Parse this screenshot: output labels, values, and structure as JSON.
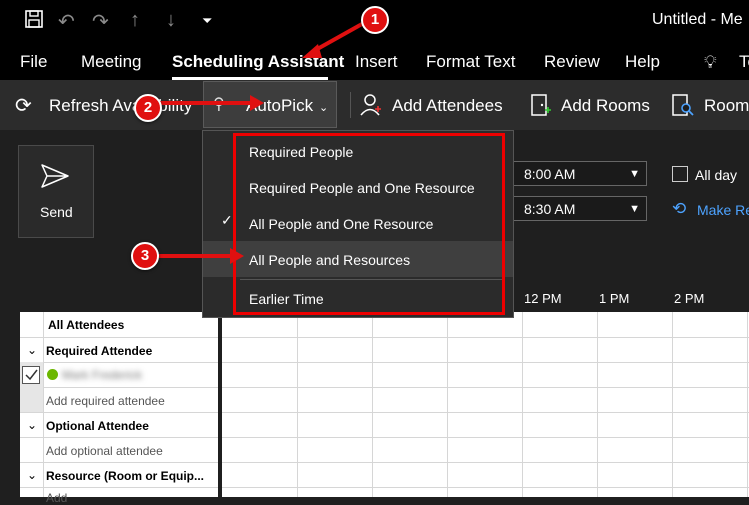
{
  "window": {
    "title": "Untitled  -  Me"
  },
  "ribbon": {
    "tabs": [
      "File",
      "Meeting",
      "Scheduling Assistant",
      "Insert",
      "Format Text",
      "Review",
      "Help",
      "Te"
    ]
  },
  "toolbar": {
    "refresh_label": "Refresh Availability",
    "autopick_label": "AutoPick",
    "add_attendees_label": "Add Attendees",
    "add_rooms_label": "Add Rooms",
    "room_finder_label": "Room"
  },
  "send": {
    "label": "Send"
  },
  "time": {
    "start_time": "8:00 AM",
    "end_time": "8:30 AM",
    "all_day_label": "All day",
    "make_recurring_label": "Make Re"
  },
  "timeline": {
    "hours": [
      "12 PM",
      "1 PM",
      "2 PM"
    ]
  },
  "attendees": {
    "header": "All Attendees",
    "required_label": "Required Attendee",
    "attendee_name": "Mark Frederick",
    "add_required_placeholder": "Add required attendee",
    "optional_label": "Optional Attendee",
    "add_optional_placeholder": "Add optional attendee",
    "resource_label": "Resource (Room or Equip...",
    "add_resource_placeholder": "Add"
  },
  "autopick_menu": {
    "items": [
      "Required People",
      "Required People and One Resource",
      "All People and One Resource",
      "All People and Resources",
      "Earlier Time"
    ],
    "checked_index": 2
  },
  "callouts": [
    "1",
    "2",
    "3"
  ],
  "colors": {
    "callout_red": "#e01010",
    "link_blue": "#4da3ff",
    "status_green": "#6bb700"
  }
}
